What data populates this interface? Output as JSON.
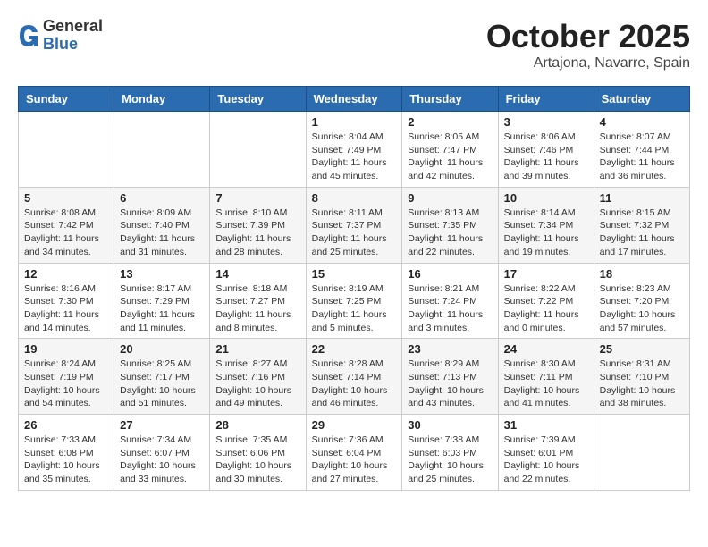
{
  "header": {
    "logo_general": "General",
    "logo_blue": "Blue",
    "month_title": "October 2025",
    "location": "Artajona, Navarre, Spain"
  },
  "days_of_week": [
    "Sunday",
    "Monday",
    "Tuesday",
    "Wednesday",
    "Thursday",
    "Friday",
    "Saturday"
  ],
  "weeks": [
    [
      {
        "day": "",
        "info": ""
      },
      {
        "day": "",
        "info": ""
      },
      {
        "day": "",
        "info": ""
      },
      {
        "day": "1",
        "info": "Sunrise: 8:04 AM\nSunset: 7:49 PM\nDaylight: 11 hours and 45 minutes."
      },
      {
        "day": "2",
        "info": "Sunrise: 8:05 AM\nSunset: 7:47 PM\nDaylight: 11 hours and 42 minutes."
      },
      {
        "day": "3",
        "info": "Sunrise: 8:06 AM\nSunset: 7:46 PM\nDaylight: 11 hours and 39 minutes."
      },
      {
        "day": "4",
        "info": "Sunrise: 8:07 AM\nSunset: 7:44 PM\nDaylight: 11 hours and 36 minutes."
      }
    ],
    [
      {
        "day": "5",
        "info": "Sunrise: 8:08 AM\nSunset: 7:42 PM\nDaylight: 11 hours and 34 minutes."
      },
      {
        "day": "6",
        "info": "Sunrise: 8:09 AM\nSunset: 7:40 PM\nDaylight: 11 hours and 31 minutes."
      },
      {
        "day": "7",
        "info": "Sunrise: 8:10 AM\nSunset: 7:39 PM\nDaylight: 11 hours and 28 minutes."
      },
      {
        "day": "8",
        "info": "Sunrise: 8:11 AM\nSunset: 7:37 PM\nDaylight: 11 hours and 25 minutes."
      },
      {
        "day": "9",
        "info": "Sunrise: 8:13 AM\nSunset: 7:35 PM\nDaylight: 11 hours and 22 minutes."
      },
      {
        "day": "10",
        "info": "Sunrise: 8:14 AM\nSunset: 7:34 PM\nDaylight: 11 hours and 19 minutes."
      },
      {
        "day": "11",
        "info": "Sunrise: 8:15 AM\nSunset: 7:32 PM\nDaylight: 11 hours and 17 minutes."
      }
    ],
    [
      {
        "day": "12",
        "info": "Sunrise: 8:16 AM\nSunset: 7:30 PM\nDaylight: 11 hours and 14 minutes."
      },
      {
        "day": "13",
        "info": "Sunrise: 8:17 AM\nSunset: 7:29 PM\nDaylight: 11 hours and 11 minutes."
      },
      {
        "day": "14",
        "info": "Sunrise: 8:18 AM\nSunset: 7:27 PM\nDaylight: 11 hours and 8 minutes."
      },
      {
        "day": "15",
        "info": "Sunrise: 8:19 AM\nSunset: 7:25 PM\nDaylight: 11 hours and 5 minutes."
      },
      {
        "day": "16",
        "info": "Sunrise: 8:21 AM\nSunset: 7:24 PM\nDaylight: 11 hours and 3 minutes."
      },
      {
        "day": "17",
        "info": "Sunrise: 8:22 AM\nSunset: 7:22 PM\nDaylight: 11 hours and 0 minutes."
      },
      {
        "day": "18",
        "info": "Sunrise: 8:23 AM\nSunset: 7:20 PM\nDaylight: 10 hours and 57 minutes."
      }
    ],
    [
      {
        "day": "19",
        "info": "Sunrise: 8:24 AM\nSunset: 7:19 PM\nDaylight: 10 hours and 54 minutes."
      },
      {
        "day": "20",
        "info": "Sunrise: 8:25 AM\nSunset: 7:17 PM\nDaylight: 10 hours and 51 minutes."
      },
      {
        "day": "21",
        "info": "Sunrise: 8:27 AM\nSunset: 7:16 PM\nDaylight: 10 hours and 49 minutes."
      },
      {
        "day": "22",
        "info": "Sunrise: 8:28 AM\nSunset: 7:14 PM\nDaylight: 10 hours and 46 minutes."
      },
      {
        "day": "23",
        "info": "Sunrise: 8:29 AM\nSunset: 7:13 PM\nDaylight: 10 hours and 43 minutes."
      },
      {
        "day": "24",
        "info": "Sunrise: 8:30 AM\nSunset: 7:11 PM\nDaylight: 10 hours and 41 minutes."
      },
      {
        "day": "25",
        "info": "Sunrise: 8:31 AM\nSunset: 7:10 PM\nDaylight: 10 hours and 38 minutes."
      }
    ],
    [
      {
        "day": "26",
        "info": "Sunrise: 7:33 AM\nSunset: 6:08 PM\nDaylight: 10 hours and 35 minutes."
      },
      {
        "day": "27",
        "info": "Sunrise: 7:34 AM\nSunset: 6:07 PM\nDaylight: 10 hours and 33 minutes."
      },
      {
        "day": "28",
        "info": "Sunrise: 7:35 AM\nSunset: 6:06 PM\nDaylight: 10 hours and 30 minutes."
      },
      {
        "day": "29",
        "info": "Sunrise: 7:36 AM\nSunset: 6:04 PM\nDaylight: 10 hours and 27 minutes."
      },
      {
        "day": "30",
        "info": "Sunrise: 7:38 AM\nSunset: 6:03 PM\nDaylight: 10 hours and 25 minutes."
      },
      {
        "day": "31",
        "info": "Sunrise: 7:39 AM\nSunset: 6:01 PM\nDaylight: 10 hours and 22 minutes."
      },
      {
        "day": "",
        "info": ""
      }
    ]
  ]
}
